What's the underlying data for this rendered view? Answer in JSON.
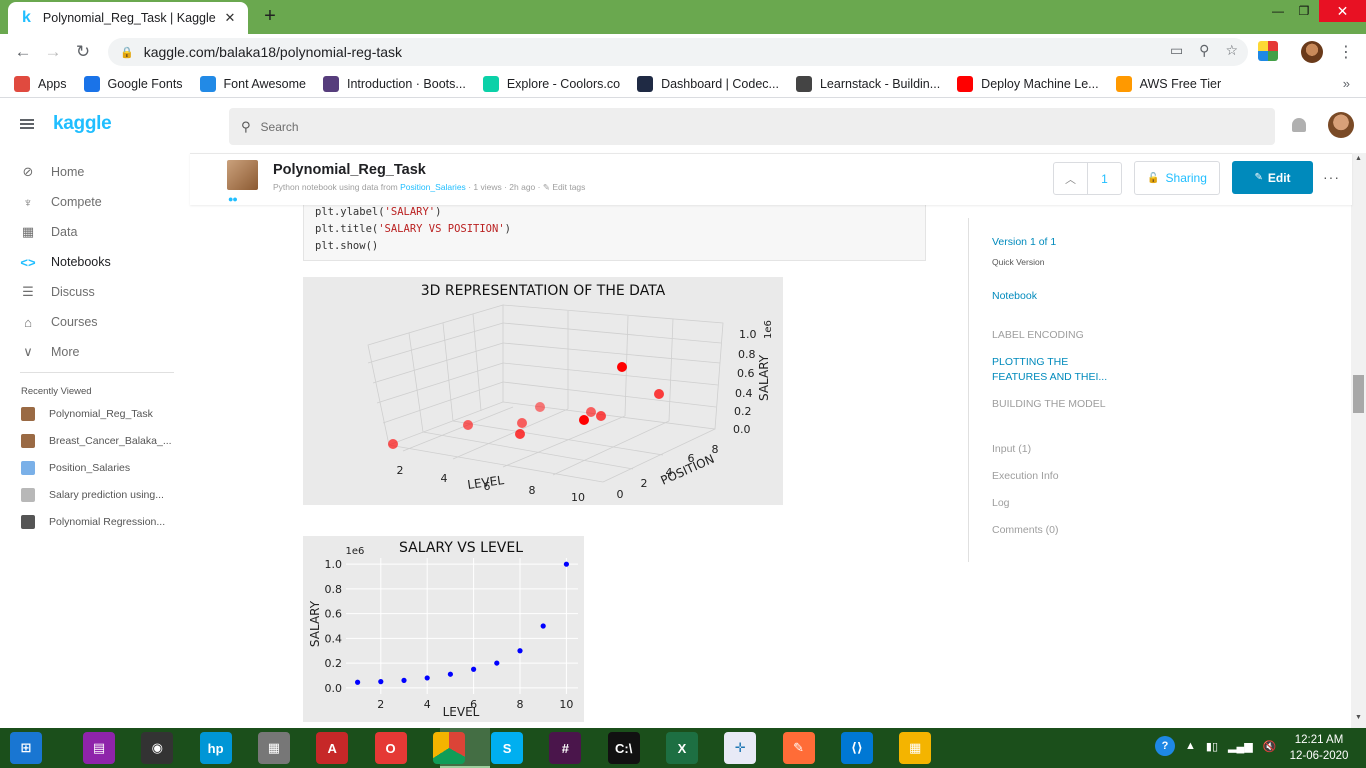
{
  "browser": {
    "tab_title": "Polynomial_Reg_Task | Kaggle",
    "tab_favicon": "k",
    "url": "kaggle.com/balaka18/polynomial-reg-task",
    "bookmarks": [
      {
        "label": "Apps",
        "icon": "apps-grid-icon",
        "color": "#e04a3f"
      },
      {
        "label": "Google Fonts",
        "icon": "google-fonts-icon",
        "color": "#1a73e8"
      },
      {
        "label": "Font Awesome",
        "icon": "font-awesome-icon",
        "color": "#228ae6"
      },
      {
        "label": "Introduction · Boots...",
        "icon": "bootstrap-icon",
        "color": "#563d7c"
      },
      {
        "label": "Explore - Coolors.co",
        "icon": "coolors-icon",
        "color": "#0bd1a8"
      },
      {
        "label": "Dashboard | Codec...",
        "icon": "codecademy-icon",
        "color": "#1f2a44"
      },
      {
        "label": "Learnstack - Buildin...",
        "icon": "learnstack-icon",
        "color": "#444444"
      },
      {
        "label": "Deploy Machine Le...",
        "icon": "youtube-icon",
        "color": "#ff0000"
      },
      {
        "label": "AWS Free Tier",
        "icon": "aws-icon",
        "color": "#ff9900"
      }
    ]
  },
  "kaggle": {
    "logo": "kaggle",
    "search_placeholder": "Search",
    "nav": [
      {
        "label": "Home",
        "icon": "compass-icon",
        "glyph": "⊘"
      },
      {
        "label": "Compete",
        "icon": "trophy-icon",
        "glyph": "♆"
      },
      {
        "label": "Data",
        "icon": "table-icon",
        "glyph": "▦"
      },
      {
        "label": "Notebooks",
        "icon": "code-icon",
        "glyph": "<>",
        "active": true
      },
      {
        "label": "Discuss",
        "icon": "discuss-icon",
        "glyph": "☰"
      },
      {
        "label": "Courses",
        "icon": "graduation-cap-icon",
        "glyph": "⌂"
      },
      {
        "label": "More",
        "icon": "chevron-down-icon",
        "glyph": "∨"
      }
    ],
    "recently_viewed_title": "Recently Viewed",
    "recent": [
      {
        "label": "Polynomial_Reg_Task",
        "color": "#9a6a44"
      },
      {
        "label": "Breast_Cancer_Balaka_...",
        "color": "#9a6a44"
      },
      {
        "label": "Position_Salaries",
        "color": "#7ab0e8"
      },
      {
        "label": "Salary prediction using...",
        "color": "#b8b8b8"
      },
      {
        "label": "Polynomial Regression...",
        "color": "#555555"
      }
    ]
  },
  "notebook": {
    "title": "Polynomial_Reg_Task",
    "subtitle_prefix": "Python notebook using data from",
    "subtitle_dataset": "Position_Salaries",
    "subtitle_meta": "· 1 views · 2h ago ·",
    "subtitle_tags": "✎ Edit tags",
    "vote_count": "1",
    "share_label": "Sharing",
    "edit_label": "Edit",
    "more_label": "···",
    "code_lines": [
      {
        "pre": "plt.ylabel(",
        "str": "'SALARY'",
        "post": ")"
      },
      {
        "pre": "plt.title(",
        "str": "'SALARY VS POSITION'",
        "post": ")"
      },
      {
        "pre": "plt.show()",
        "str": "",
        "post": ""
      }
    ]
  },
  "toc": {
    "version": "Version 1 of 1",
    "version_sub": "Quick Version",
    "notebook": "Notebook",
    "sections": [
      {
        "label": "LABEL ENCODING",
        "active": false
      },
      {
        "label": "PLOTTING THE FEATURES AND THEI...",
        "active": true
      },
      {
        "label": "BUILDING THE MODEL",
        "active": false
      }
    ],
    "links": [
      "Input (1)",
      "Execution Info",
      "Log",
      "Comments (0)"
    ]
  },
  "chart_data": [
    {
      "type": "scatter",
      "title": "3D REPRESENTATION OF THE DATA",
      "projection": "3d",
      "xlabel": "LEVEL",
      "ylabel": "POSITION",
      "zlabel": "SALARY",
      "zscale_label": "1e6",
      "xticks": [
        "2",
        "4",
        "6",
        "8",
        "10"
      ],
      "yticks": [
        "0",
        "2",
        "4",
        "6",
        "8"
      ],
      "zticks": [
        "0.0",
        "0.2",
        "0.4",
        "0.6",
        "0.8",
        "1.0"
      ],
      "marker_color": "#ff0000",
      "grid": true
    },
    {
      "type": "scatter",
      "title": "SALARY VS LEVEL",
      "xlabel": "LEVEL",
      "ylabel": "SALARY",
      "yscale_label": "1e6",
      "x": [
        1,
        2,
        3,
        4,
        5,
        6,
        7,
        8,
        9,
        10
      ],
      "y": [
        0.045,
        0.05,
        0.06,
        0.08,
        0.11,
        0.15,
        0.2,
        0.3,
        0.5,
        1.0
      ],
      "xlim": [
        0.5,
        10.5
      ],
      "ylim": [
        -0.05,
        1.05
      ],
      "xticks": [
        2,
        4,
        6,
        8,
        10
      ],
      "yticks": [
        0.0,
        0.2,
        0.4,
        0.6,
        0.8,
        1.0
      ],
      "marker_color": "#0000ff",
      "grid": true
    }
  ],
  "taskbar": {
    "apps": [
      "windows-start-icon",
      "winrar-icon",
      "camera-icon",
      "hp-icon",
      "unknown-app-icon",
      "acrobat-icon",
      "opera-icon",
      "chrome-icon",
      "skype-icon",
      "slack-icon",
      "cmd-icon",
      "excel-icon",
      "tableau-icon",
      "postman-icon",
      "vscode-icon",
      "color-picker-icon"
    ],
    "time": "12:21 AM",
    "date": "12-06-2020"
  }
}
